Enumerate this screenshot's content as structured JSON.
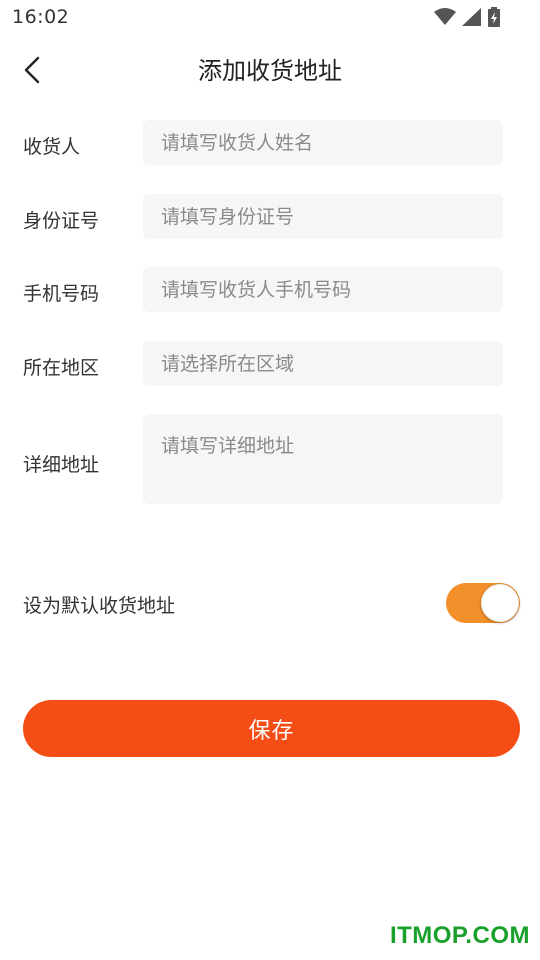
{
  "status_bar": {
    "time": "16:02",
    "icons": [
      "wifi-icon",
      "cell-signal-icon",
      "battery-charging-icon"
    ]
  },
  "header": {
    "title": "添加收货地址",
    "back_icon": "chevron-left-icon"
  },
  "form": {
    "consignee": {
      "label": "收货人",
      "placeholder": "请填写收货人姓名",
      "value": ""
    },
    "id_number": {
      "label": "身份证号",
      "placeholder": "请填写身份证号",
      "value": ""
    },
    "phone": {
      "label": "手机号码",
      "placeholder": "请填写收货人手机号码",
      "value": ""
    },
    "region": {
      "label": "所在地区",
      "placeholder": "请选择所在区域",
      "value": ""
    },
    "address": {
      "label": "详细地址",
      "placeholder": "请填写详细地址",
      "value": ""
    }
  },
  "default_setting": {
    "label": "设为默认收货地址",
    "enabled": true
  },
  "save_button": {
    "label": "保存"
  },
  "watermark": "ITMOP.COM",
  "colors": {
    "accent": "#f44d15",
    "toggle_on": "#f38f2b",
    "input_bg": "#f6f6f6",
    "watermark": "#1aa12c"
  }
}
